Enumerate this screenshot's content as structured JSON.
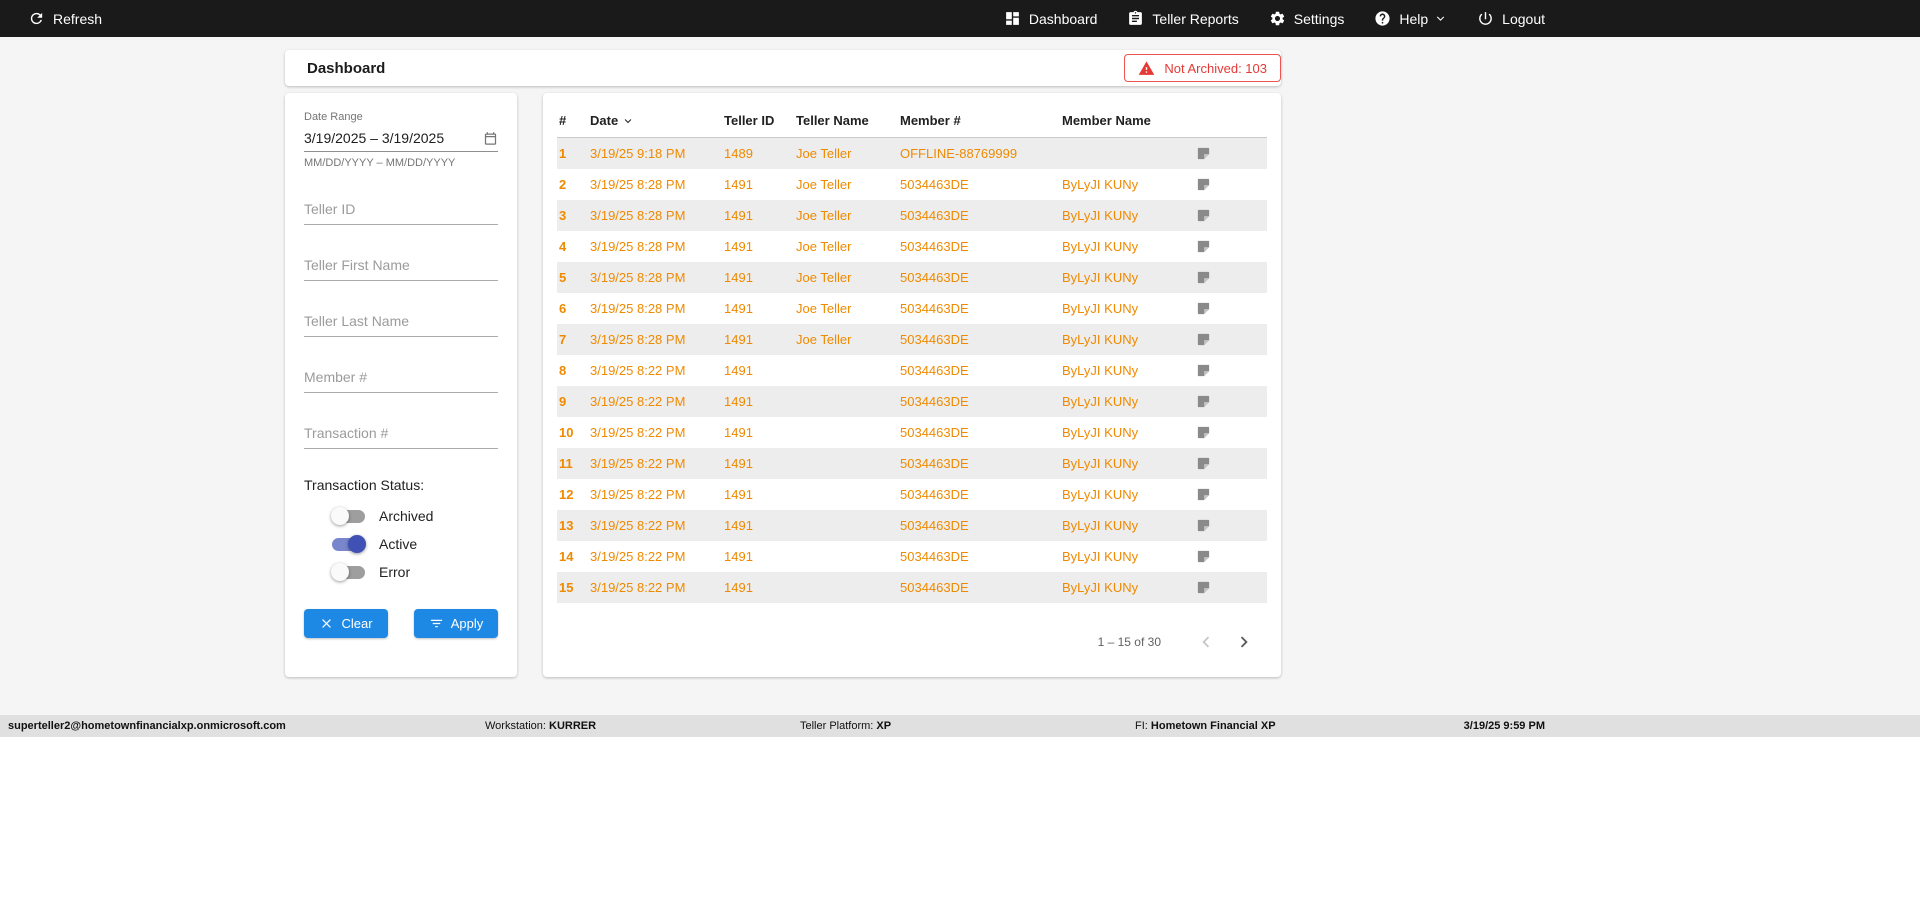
{
  "navbar": {
    "refresh_label": "Refresh",
    "dashboard_label": "Dashboard",
    "teller_reports_label": "Teller Reports",
    "settings_label": "Settings",
    "help_label": "Help",
    "logout_label": "Logout"
  },
  "page": {
    "title": "Dashboard",
    "not_archived_badge": "Not Archived: 103"
  },
  "filters": {
    "date_range_label": "Date Range",
    "date_range_value": "3/19/2025 – 3/19/2025",
    "date_range_hint": "MM/DD/YYYY – MM/DD/YYYY",
    "teller_id_placeholder": "Teller ID",
    "teller_first_name_placeholder": "Teller First Name",
    "teller_last_name_placeholder": "Teller Last Name",
    "member_number_placeholder": "Member #",
    "transaction_number_placeholder": "Transaction #",
    "status_label": "Transaction Status:",
    "toggles": [
      {
        "label": "Archived",
        "on": false
      },
      {
        "label": "Active",
        "on": true
      },
      {
        "label": "Error",
        "on": false
      }
    ],
    "clear_label": "Clear",
    "apply_label": "Apply"
  },
  "table": {
    "columns": {
      "number": "#",
      "date": "Date",
      "teller_id": "Teller ID",
      "teller_name": "Teller Name",
      "member_number": "Member #",
      "member_name": "Member Name"
    },
    "rows": [
      {
        "num": "1",
        "date": "3/19/25 9:18 PM",
        "teller_id": "1489",
        "teller_name": "Joe Teller",
        "member_number": "OFFLINE-88769999",
        "member_name": ""
      },
      {
        "num": "2",
        "date": "3/19/25 8:28 PM",
        "teller_id": "1491",
        "teller_name": "Joe Teller",
        "member_number": "5034463DE",
        "member_name": "ByLyJI KUNy"
      },
      {
        "num": "3",
        "date": "3/19/25 8:28 PM",
        "teller_id": "1491",
        "teller_name": "Joe Teller",
        "member_number": "5034463DE",
        "member_name": "ByLyJI KUNy"
      },
      {
        "num": "4",
        "date": "3/19/25 8:28 PM",
        "teller_id": "1491",
        "teller_name": "Joe Teller",
        "member_number": "5034463DE",
        "member_name": "ByLyJI KUNy"
      },
      {
        "num": "5",
        "date": "3/19/25 8:28 PM",
        "teller_id": "1491",
        "teller_name": "Joe Teller",
        "member_number": "5034463DE",
        "member_name": "ByLyJI KUNy"
      },
      {
        "num": "6",
        "date": "3/19/25 8:28 PM",
        "teller_id": "1491",
        "teller_name": "Joe Teller",
        "member_number": "5034463DE",
        "member_name": "ByLyJI KUNy"
      },
      {
        "num": "7",
        "date": "3/19/25 8:28 PM",
        "teller_id": "1491",
        "teller_name": "Joe Teller",
        "member_number": "5034463DE",
        "member_name": "ByLyJI KUNy"
      },
      {
        "num": "8",
        "date": "3/19/25 8:22 PM",
        "teller_id": "1491",
        "teller_name": "",
        "member_number": "5034463DE",
        "member_name": "ByLyJI KUNy"
      },
      {
        "num": "9",
        "date": "3/19/25 8:22 PM",
        "teller_id": "1491",
        "teller_name": "",
        "member_number": "5034463DE",
        "member_name": "ByLyJI KUNy"
      },
      {
        "num": "10",
        "date": "3/19/25 8:22 PM",
        "teller_id": "1491",
        "teller_name": "",
        "member_number": "5034463DE",
        "member_name": "ByLyJI KUNy"
      },
      {
        "num": "11",
        "date": "3/19/25 8:22 PM",
        "teller_id": "1491",
        "teller_name": "",
        "member_number": "5034463DE",
        "member_name": "ByLyJI KUNy"
      },
      {
        "num": "12",
        "date": "3/19/25 8:22 PM",
        "teller_id": "1491",
        "teller_name": "",
        "member_number": "5034463DE",
        "member_name": "ByLyJI KUNy"
      },
      {
        "num": "13",
        "date": "3/19/25 8:22 PM",
        "teller_id": "1491",
        "teller_name": "",
        "member_number": "5034463DE",
        "member_name": "ByLyJI KUNy"
      },
      {
        "num": "14",
        "date": "3/19/25 8:22 PM",
        "teller_id": "1491",
        "teller_name": "",
        "member_number": "5034463DE",
        "member_name": "ByLyJI KUNy"
      },
      {
        "num": "15",
        "date": "3/19/25 8:22 PM",
        "teller_id": "1491",
        "teller_name": "",
        "member_number": "5034463DE",
        "member_name": "ByLyJI KUNy"
      }
    ],
    "pagination": {
      "range_label": "1 – 15 of 30"
    }
  },
  "statusbar": {
    "user_email": "superteller2@hometownfinancialxp.onmicrosoft.com",
    "workstation_label": "Workstation:",
    "workstation_value": "KURRER",
    "teller_platform_label": "Teller Platform:",
    "teller_platform_value": "XP",
    "fi_label": "FI:",
    "fi_value": "Hometown Financial XP",
    "datetime": "3/19/25 9:59 PM"
  },
  "colors": {
    "topbar_bg": "#1a1a1a",
    "accent_orange": "#EF8A00",
    "primary_blue": "#1E88E5",
    "toggle_on_blue": "#3F51B5",
    "alert_red": "#E53935",
    "row_alt_gray": "#EDEDED"
  },
  "icons": {
    "refresh-icon": "circular-arrow",
    "dashboard-icon": "grid-tiles",
    "reports-icon": "clipboard",
    "gear-icon": "gear",
    "help-icon": "question-circle",
    "chevron-down-icon": "chevron-down",
    "power-icon": "power-symbol",
    "warning-icon": "triangle-exclamation",
    "calendar-icon": "calendar",
    "close-icon": "x-cross",
    "filter-icon": "filter-lines",
    "sort-desc-icon": "chevron-down",
    "note-icon": "sticky-note",
    "chevron-left-icon": "chevron-left",
    "chevron-right-icon": "chevron-right"
  }
}
